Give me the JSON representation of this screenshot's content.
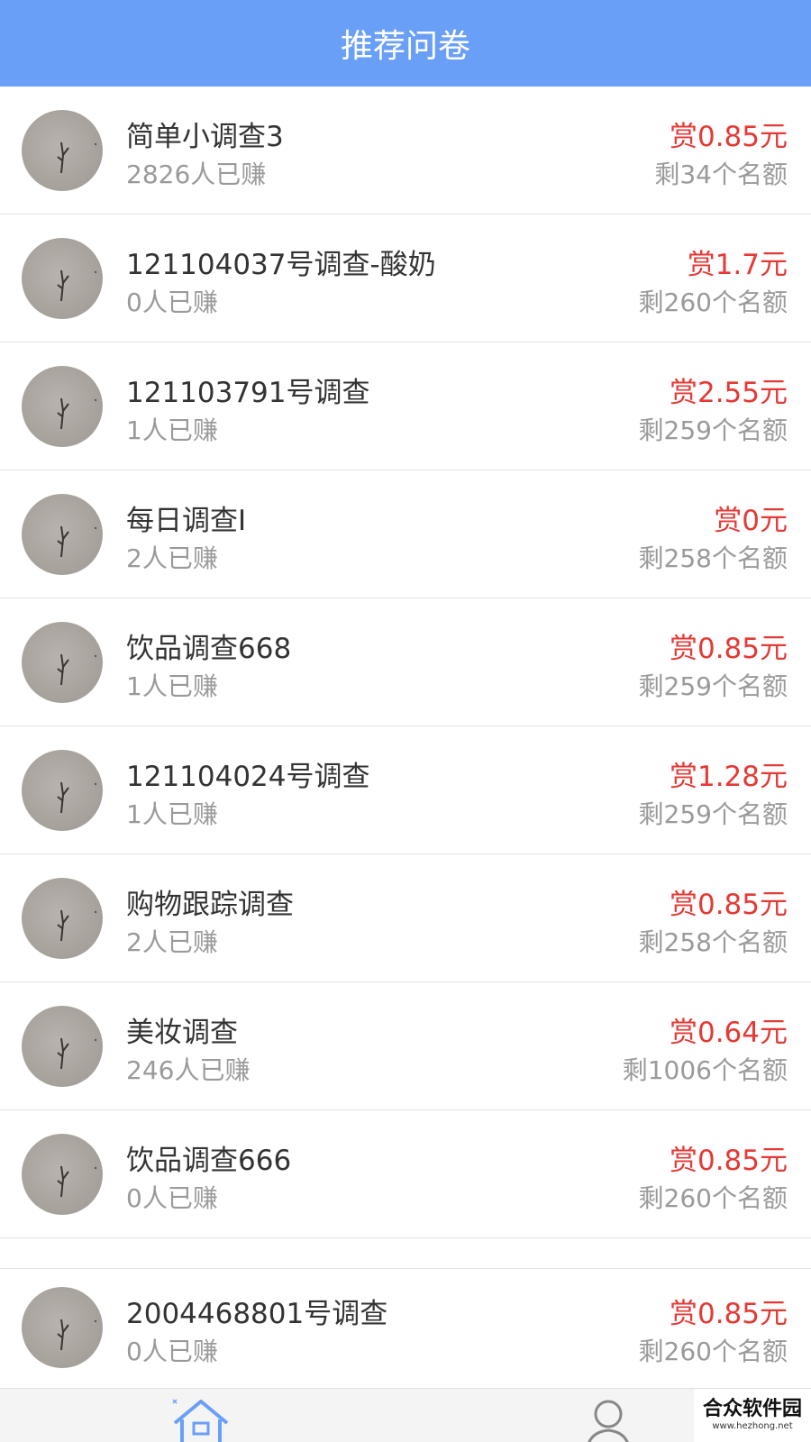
{
  "header": {
    "title": "推荐问卷"
  },
  "surveys": [
    {
      "title": "简单小调查3",
      "earned": "2826人已赚",
      "reward": "赏0.85元",
      "quota": "剩34个名额"
    },
    {
      "title": "121104037号调查-酸奶",
      "earned": "0人已赚",
      "reward": "赏1.7元",
      "quota": "剩260个名额"
    },
    {
      "title": "121103791号调查",
      "earned": "1人已赚",
      "reward": "赏2.55元",
      "quota": "剩259个名额"
    },
    {
      "title": "每日调查I",
      "earned": "2人已赚",
      "reward": "赏0元",
      "quota": "剩258个名额"
    },
    {
      "title": "饮品调查668",
      "earned": "1人已赚",
      "reward": "赏0.85元",
      "quota": "剩259个名额"
    },
    {
      "title": "121104024号调查",
      "earned": "1人已赚",
      "reward": "赏1.28元",
      "quota": "剩259个名额"
    },
    {
      "title": "购物跟踪调查",
      "earned": "2人已赚",
      "reward": "赏0.85元",
      "quota": "剩258个名额"
    },
    {
      "title": "美妆调查",
      "earned": "246人已赚",
      "reward": "赏0.64元",
      "quota": "剩1006个名额"
    },
    {
      "title": "饮品调查666",
      "earned": "0人已赚",
      "reward": "赏0.85元",
      "quota": "剩260个名额"
    }
  ],
  "featured": {
    "title": "2004468801号调查",
    "earned": "0人已赚",
    "reward": "赏0.85元",
    "quota": "剩260个名额"
  },
  "tabbar": {
    "home_icon": "home-icon",
    "profile_icon": "user-icon",
    "accent": "#6a9ff8"
  },
  "watermark": {
    "title": "合众软件园",
    "url": "www.hezhong.net"
  },
  "colors": {
    "header_bg": "#6a9ff8",
    "reward": "#e53935",
    "muted": "#9a9a9a",
    "text": "#333333"
  }
}
